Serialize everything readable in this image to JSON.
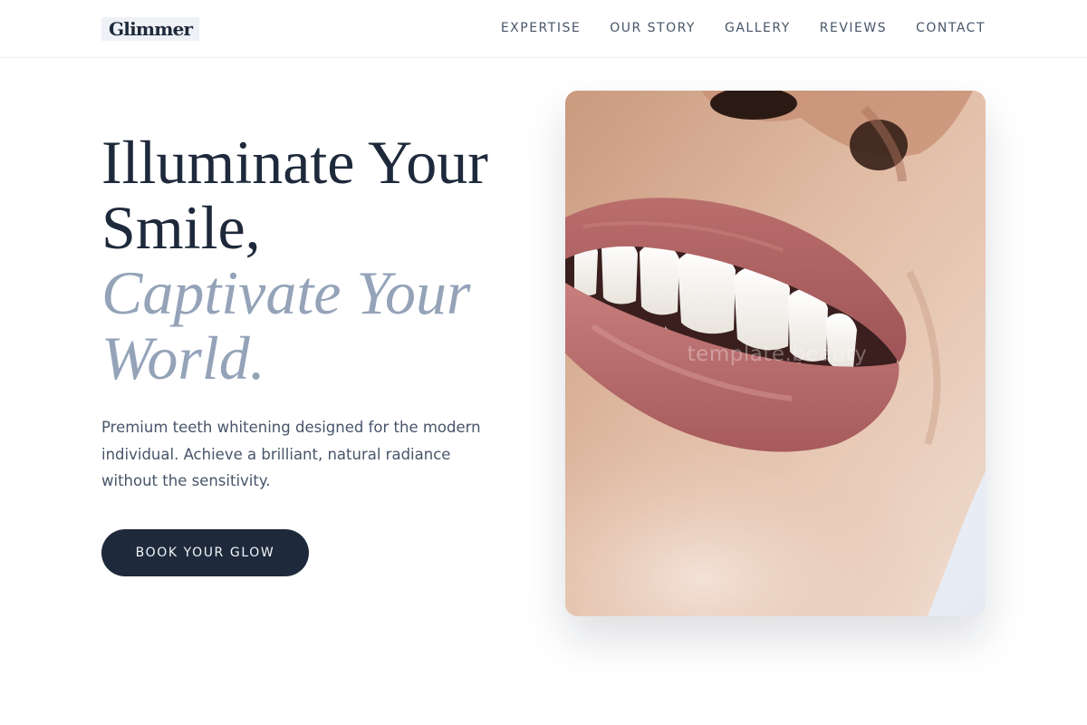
{
  "header": {
    "logo": "Glimmer",
    "nav": [
      {
        "label": "EXPERTISE"
      },
      {
        "label": "OUR STORY"
      },
      {
        "label": "GALLERY"
      },
      {
        "label": "REVIEWS"
      },
      {
        "label": "CONTACT"
      }
    ]
  },
  "hero": {
    "headline_line1": "Illuminate Your",
    "headline_line2": "Smile,",
    "headline_accent_line1": "Captivate Your",
    "headline_accent_line2": "World.",
    "description": "Premium teeth whitening designed for the modern individual. Achieve a brilliant, natural radiance without the sensitivity.",
    "cta_label": "BOOK YOUR GLOW",
    "image": {
      "subject": "close-up of a smiling mouth with white teeth and mauve lips",
      "watermark": "template.beauty"
    }
  },
  "colors": {
    "primary": "#1e293b",
    "accent_text": "#94a3b8",
    "body_text": "#475569",
    "background": "#ffffff"
  }
}
